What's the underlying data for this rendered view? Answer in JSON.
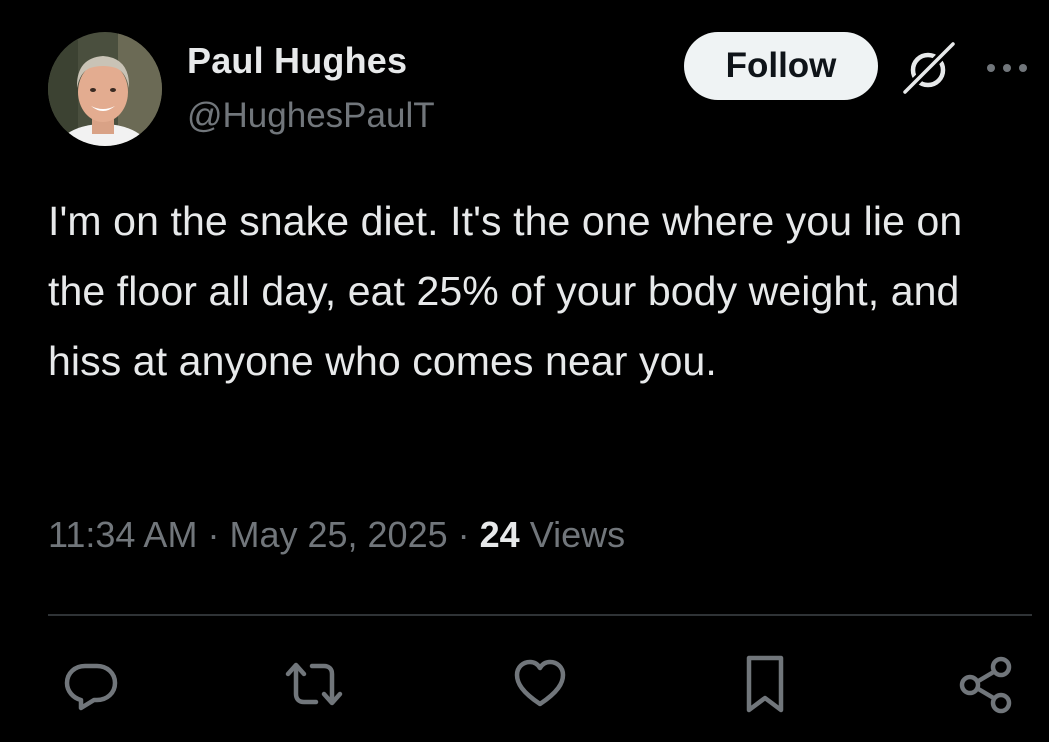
{
  "author": {
    "display_name": "Paul Hughes",
    "handle": "@HughesPaulT"
  },
  "header_actions": {
    "follow_label": "Follow",
    "grok_icon": "grok-icon",
    "more_icon": "more-horizontal-icon"
  },
  "tweet": {
    "text": "I'm on the snake diet. It's the one where you lie on the floor all day, eat 25% of your body weight, and hiss at anyone who comes near you."
  },
  "meta": {
    "time": "11:34 AM",
    "separator": "·",
    "date": "May 25, 2025",
    "views_count": "24",
    "views_label": "Views"
  },
  "actions": [
    {
      "name": "reply",
      "icon": "reply-icon"
    },
    {
      "name": "retweet",
      "icon": "retweet-icon"
    },
    {
      "name": "like",
      "icon": "heart-icon"
    },
    {
      "name": "bookmark",
      "icon": "bookmark-icon"
    },
    {
      "name": "share",
      "icon": "share-icon"
    }
  ],
  "colors": {
    "background": "#000000",
    "primary_text": "#e7e9ea",
    "secondary_text": "#71767b",
    "follow_bg": "#eff3f4",
    "follow_text": "#0f1419",
    "divider": "#2f3336"
  }
}
